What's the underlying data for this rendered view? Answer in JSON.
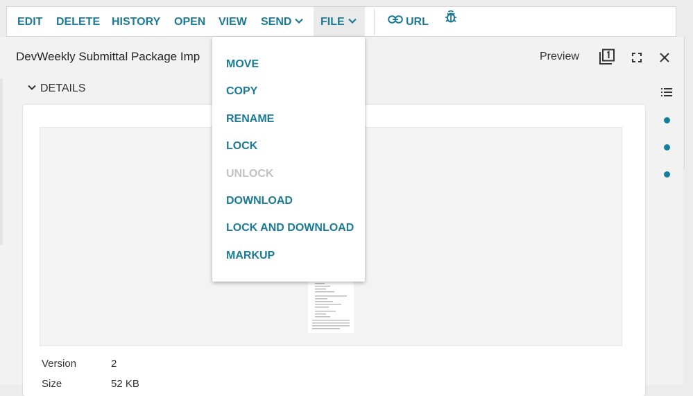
{
  "toolbar": {
    "edit": "EDIT",
    "delete": "DELETE",
    "history": "HISTORY",
    "open": "OPEN",
    "view": "VIEW",
    "send": "SEND",
    "file": "FILE",
    "url": "URL"
  },
  "document": {
    "title": "DevWeekly Submittal Package Imp",
    "preview_label": "Preview",
    "details_label": "DETAILS"
  },
  "file_menu": {
    "items": [
      {
        "label": "MOVE",
        "enabled": true
      },
      {
        "label": "COPY",
        "enabled": true
      },
      {
        "label": "RENAME",
        "enabled": true
      },
      {
        "label": "LOCK",
        "enabled": true
      },
      {
        "label": "UNLOCK",
        "enabled": false
      },
      {
        "label": "DOWNLOAD",
        "enabled": true
      },
      {
        "label": "LOCK AND DOWNLOAD",
        "enabled": true
      },
      {
        "label": "MARKUP",
        "enabled": true
      }
    ]
  },
  "details": {
    "version_label": "Version",
    "version_value": "2",
    "size_label": "Size",
    "size_value": "52 KB"
  },
  "colors": {
    "accent": "#1b7a96",
    "disabled": "#c2c2c2",
    "dot": "#137f9a"
  }
}
